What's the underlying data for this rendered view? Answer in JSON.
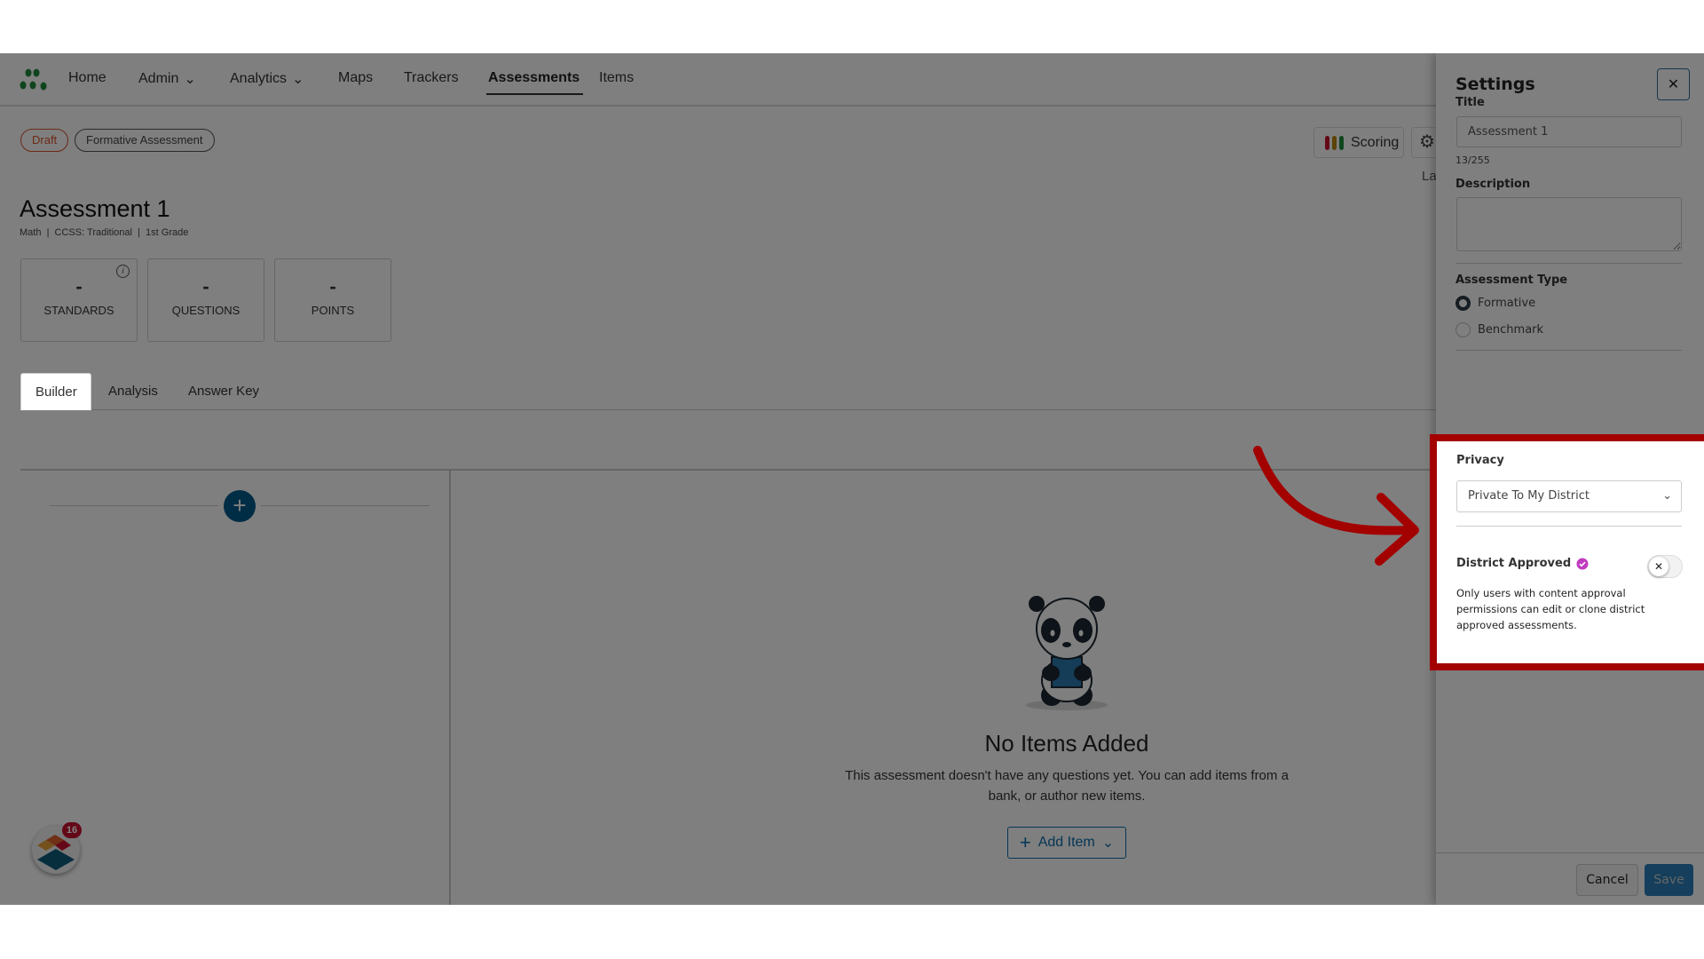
{
  "nav": {
    "items": [
      {
        "label": "Home"
      },
      {
        "label": "Admin",
        "dropdown": true
      },
      {
        "label": "Analytics",
        "dropdown": true
      },
      {
        "label": "Maps"
      },
      {
        "label": "Trackers"
      },
      {
        "label": "Assessments",
        "active": true
      },
      {
        "label": "Items"
      }
    ]
  },
  "header": {
    "status_badge": "Draft",
    "type_badge": "Formative Assessment",
    "title": "Assessment 1",
    "subtitle": "Math  |  CCSS: Traditional  |  1st Grade",
    "scoring_label": "Scoring",
    "truncated_label": "La"
  },
  "stats": [
    {
      "value": "-",
      "label": "STANDARDS"
    },
    {
      "value": "-",
      "label": "QUESTIONS"
    },
    {
      "value": "-",
      "label": "POINTS"
    }
  ],
  "tabs": [
    {
      "label": "Builder",
      "active": true
    },
    {
      "label": "Analysis"
    },
    {
      "label": "Answer Key"
    }
  ],
  "empty_state": {
    "title": "No Items Added",
    "description": "This assessment doesn't have any questions yet. You can add items from a bank, or author new items.",
    "add_item_label": "Add Item"
  },
  "widget": {
    "badge_count": "16"
  },
  "settings": {
    "heading": "Settings",
    "title_label": "Title",
    "title_value": "Assessment 1",
    "char_count": "13/255",
    "description_label": "Description",
    "description_value": "",
    "assessment_type_label": "Assessment Type",
    "types": [
      {
        "label": "Formative",
        "selected": true
      },
      {
        "label": "Benchmark",
        "selected": false
      }
    ],
    "privacy_label": "Privacy",
    "privacy_value": "Private To My District",
    "district_approved_label": "District Approved",
    "district_approved": false,
    "district_approved_help": "Only users with content approval permissions can edit or clone district approved assessments.",
    "cancel_label": "Cancel",
    "save_label": "Save"
  },
  "colors": {
    "highlight": "#a30000",
    "accent": "#005a8c",
    "draft": "#d9532c",
    "verified_badge": "#c03cc0",
    "scoring_bars": [
      "#c8102e",
      "#b8860b",
      "#1e8a3c"
    ]
  }
}
